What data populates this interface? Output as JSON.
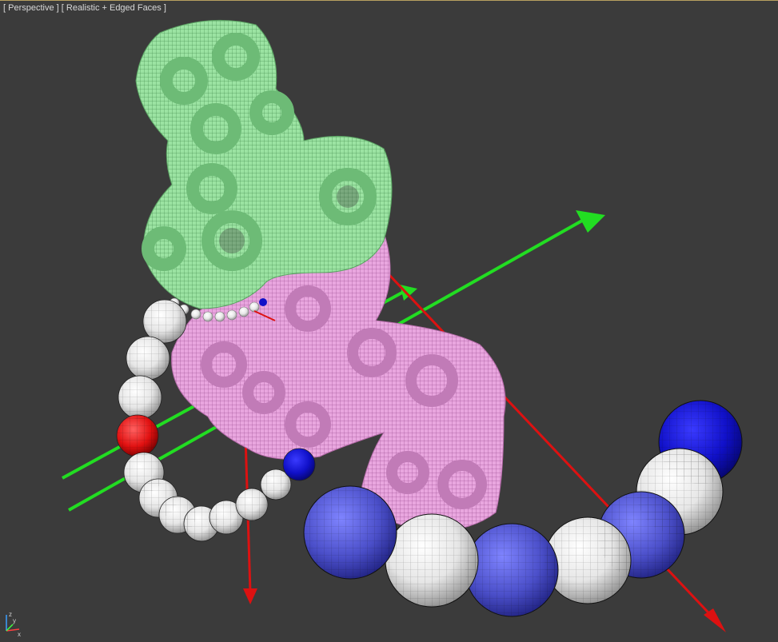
{
  "viewport": {
    "view_label": "[ Perspective ]",
    "shading_label": "[ Realistic + Edged Faces ]"
  },
  "tripod": {
    "z_label": "z",
    "x_label": "x",
    "y_label": "y"
  },
  "colors": {
    "background": "#3b3b3b",
    "green_tori": "#9be3a2",
    "pink_tori": "#e9a6df",
    "white_sphere": "#f2f2f2",
    "blue_sphere": "#4b4fc9",
    "dark_blue_sphere": "#1010c8",
    "red_sphere": "#e01010",
    "green_arrow": "#22dd22",
    "red_arrow": "#dd1111"
  },
  "icons": [
    "axis-tripod-icon"
  ]
}
